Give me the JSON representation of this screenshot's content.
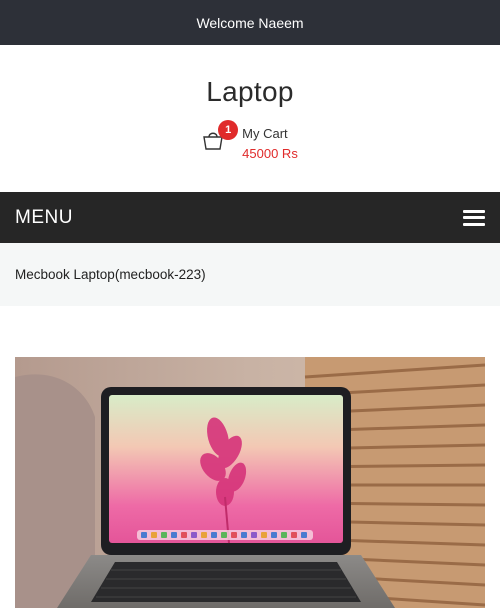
{
  "topbar": {
    "welcome": "Welcome Naeem"
  },
  "site": {
    "title": "Laptop"
  },
  "cart": {
    "count": "1",
    "label": "My Cart",
    "total": "45000 Rs"
  },
  "menu": {
    "label": "MENU"
  },
  "breadcrumb": {
    "text": "Mecbook Laptop(mecbook-223)"
  },
  "colors": {
    "topbar": "#2d3038",
    "menubar": "#262626",
    "accent": "#e02b2b",
    "breadcrumb_bg": "#f5f7f7"
  },
  "icons": {
    "cart": "shopping-bag-icon",
    "menu": "hamburger-icon"
  }
}
